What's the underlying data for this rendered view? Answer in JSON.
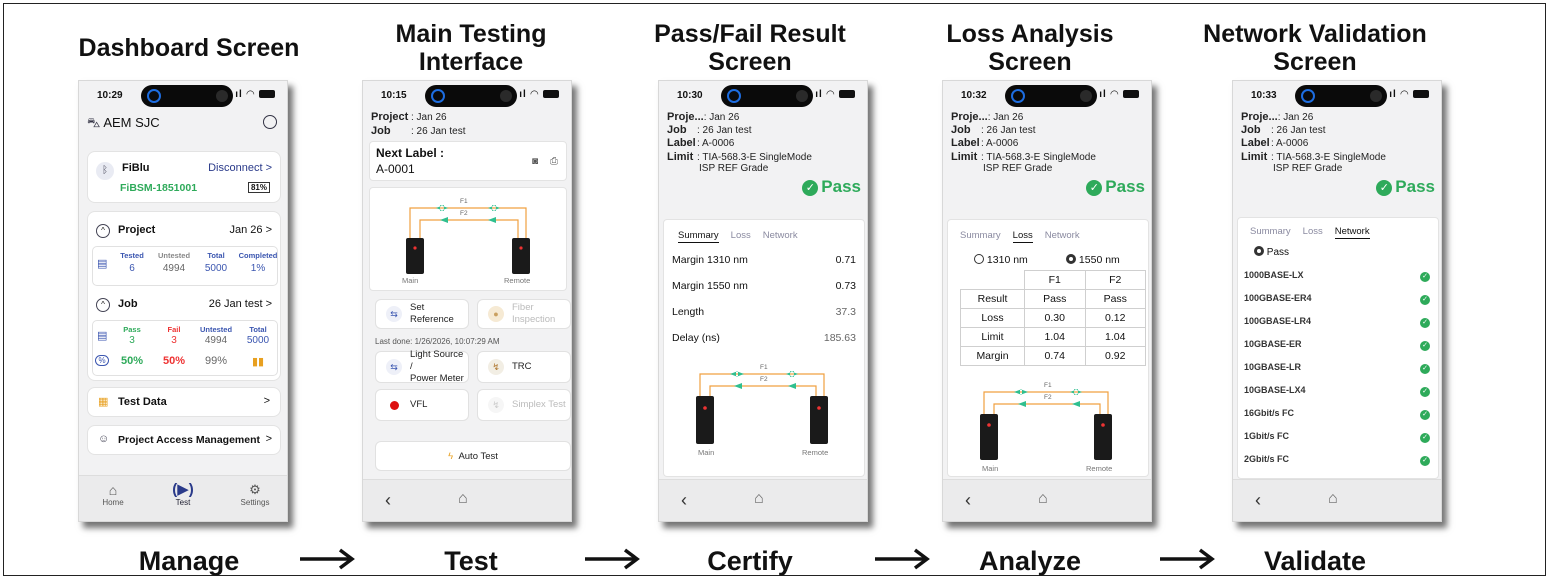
{
  "columns": [
    {
      "title_lines": [
        "Dashboard Screen"
      ],
      "step": "Manage"
    },
    {
      "title_lines": [
        "Main Testing",
        "Interface"
      ],
      "step": "Test"
    },
    {
      "title_lines": [
        "Pass/Fail Result",
        "Screen"
      ],
      "step": "Certify"
    },
    {
      "title_lines": [
        "Loss Analysis",
        "Screen"
      ],
      "step": "Analyze"
    },
    {
      "title_lines": [
        "Network Validation",
        "Screen"
      ],
      "step": "Validate"
    }
  ],
  "dashboard": {
    "time": "10:29",
    "org": "AEM SJC",
    "device_name": "FiBlu",
    "disconnect": "Disconnect >",
    "device_id": "FiBSM-1851001",
    "battery": "81%",
    "project_label": "Project",
    "project_value": "Jan 26 >",
    "proj_stats_labels": [
      "Tested",
      "Untested",
      "Total",
      "Completed"
    ],
    "proj_stats_values": [
      "6",
      "4994",
      "5000",
      "1%"
    ],
    "job_label": "Job",
    "job_value": "26 Jan test >",
    "job_stats_labels": [
      "Pass",
      "Fail",
      "Untested",
      "Total"
    ],
    "job_stats_values": [
      "3",
      "3",
      "4994",
      "5000"
    ],
    "job_pct": [
      "50%",
      "50%",
      "99%"
    ],
    "test_data": "Test Data",
    "access_mgmt": "Project Access Management",
    "nav": [
      "Home",
      "Test",
      "Settings"
    ]
  },
  "testing": {
    "time": "10:15",
    "project_key": "Project",
    "project_val": ": Jan 26",
    "job_key": "Job",
    "job_val": ": 26 Jan test",
    "next_label_title": "Next Label :",
    "next_label_value": "A-0001",
    "diagram_main": "Main",
    "diagram_remote": "Remote",
    "f1": "F1",
    "f2": "F2",
    "set_reference": "Set Reference",
    "fiber_inspection": "Fiber Inspection",
    "last_done": "Last done: 1/26/2026, 10:07:29 AM",
    "light_source": [
      "Light Source /",
      "Power Meter"
    ],
    "trc": "TRC",
    "vfl": "VFL",
    "simplex": "Simplex Test",
    "auto_test": "Auto Test"
  },
  "result": {
    "time": "10:30",
    "project_key": "Proje...",
    "project_val": ": Jan 26",
    "job_key": "Job",
    "job_val": ": 26 Jan test",
    "label_key": "Label",
    "label_val": ": A-0006",
    "limit_key": "Limit",
    "limit_val": ": TIA-568.3-E SingleMode",
    "limit_val2": "ISP REF Grade",
    "pass": "Pass",
    "tabs": [
      "Summary",
      "Loss",
      "Network"
    ],
    "rows": [
      {
        "k": "Margin 1310 nm",
        "v": "0.71"
      },
      {
        "k": "Margin 1550 nm",
        "v": "0.73"
      },
      {
        "k": "Length",
        "v": "37.3"
      },
      {
        "k": "Delay (ns)",
        "v": "185.63"
      }
    ],
    "diagram_main": "Main",
    "diagram_remote": "Remote",
    "f1": "F1",
    "f2": "F2"
  },
  "loss": {
    "time": "10:32",
    "project_key": "Proje...",
    "project_val": ": Jan 26",
    "job_key": "Job",
    "job_val": ": 26 Jan test",
    "label_key": "Label",
    "label_val": ": A-0006",
    "limit_key": "Limit",
    "limit_val": ": TIA-568.3-E SingleMode",
    "limit_val2": "ISP REF Grade",
    "pass": "Pass",
    "tabs": [
      "Summary",
      "Loss",
      "Network"
    ],
    "wl1": "1310 nm",
    "wl2": "1550 nm",
    "table_head": [
      "",
      "F1",
      "F2"
    ],
    "table_rows": [
      [
        "Result",
        "Pass",
        "Pass"
      ],
      [
        "Loss",
        "0.30",
        "0.12"
      ],
      [
        "Limit",
        "1.04",
        "1.04"
      ],
      [
        "Margin",
        "0.74",
        "0.92"
      ]
    ],
    "diagram_main": "Main",
    "diagram_remote": "Remote",
    "f1": "F1",
    "f2": "F2"
  },
  "network": {
    "time": "10:33",
    "project_key": "Proje...",
    "project_val": ": Jan 26",
    "job_key": "Job",
    "job_val": ": 26 Jan test",
    "label_key": "Label",
    "label_val": ": A-0006",
    "limit_key": "Limit",
    "limit_val": ": TIA-568.3-E SingleMode",
    "limit_val2": "ISP REF Grade",
    "pass": "Pass",
    "tabs": [
      "Summary",
      "Loss",
      "Network"
    ],
    "filter": "Pass",
    "items": [
      "1000BASE-LX",
      "100GBASE-ER4",
      "100GBASE-LR4",
      "10GBASE-ER",
      "10GBASE-LR",
      "10GBASE-LX4",
      "16Gbit/s FC",
      "1Gbit/s FC",
      "2Gbit/s FC"
    ]
  },
  "colors": {
    "accent_green": "#2eaa5a",
    "fiber_orange": "#f0a040",
    "arrow_teal": "#2fbf8f",
    "fail_red": "#e33333",
    "link_blue": "#2a6fd6"
  }
}
